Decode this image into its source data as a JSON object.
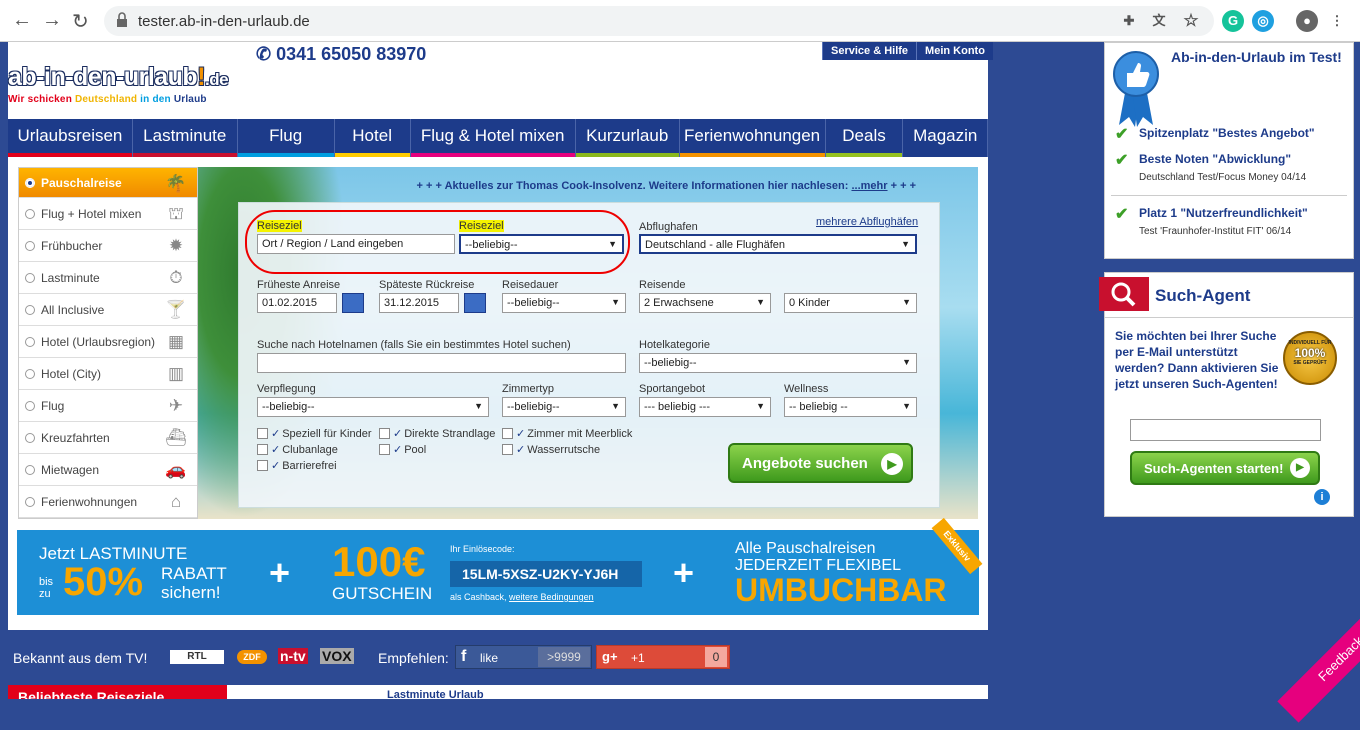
{
  "browser": {
    "url": "tester.ab-in-den-urlaub.de"
  },
  "header": {
    "phone": "0341 65050 83970",
    "service_btn": "Service & Hilfe",
    "account_btn": "Mein Konto",
    "logo_main": "ab-in-den-urlaub",
    "logo_excl": "!",
    "logo_de": ".de",
    "slogan_1": "Wir schicken ",
    "slogan_2": "Deutschland",
    "slogan_3": " in den ",
    "slogan_4": "Urlaub"
  },
  "nav": [
    {
      "label": "Urlaubsreisen",
      "color": "#e2001a"
    },
    {
      "label": "Lastminute",
      "color": "#c8102e"
    },
    {
      "label": "Flug",
      "color": "#009ee0"
    },
    {
      "label": "Hotel",
      "color": "#ffcc00"
    },
    {
      "label": "Flug & Hotel mixen",
      "color": "#e6007e"
    },
    {
      "label": "Kurzurlaub",
      "color": "#8ab81c"
    },
    {
      "label": "Ferienwohnungen",
      "color": "#f39200"
    },
    {
      "label": "Deals",
      "color": "#95c11f"
    },
    {
      "label": "Magazin",
      "color": "#1d3b8a"
    }
  ],
  "sidebar": [
    {
      "label": "Pauschalreise",
      "icon": "palm-icon"
    },
    {
      "label": "Flug + Hotel mixen",
      "icon": "eiffel-icon"
    },
    {
      "label": "Frühbucher",
      "icon": "sun-icon"
    },
    {
      "label": "Lastminute",
      "icon": "stopwatch-icon"
    },
    {
      "label": "All Inclusive",
      "icon": "cocktail-icon"
    },
    {
      "label": "Hotel (Urlaubsregion)",
      "icon": "suitcase-icon"
    },
    {
      "label": "Hotel (City)",
      "icon": "building-icon"
    },
    {
      "label": "Flug",
      "icon": "plane-icon"
    },
    {
      "label": "Kreuzfahrten",
      "icon": "ship-icon"
    },
    {
      "label": "Mietwagen",
      "icon": "car-icon"
    },
    {
      "label": "Ferienwohnungen",
      "icon": "house-icon"
    }
  ],
  "ticker": {
    "prefix": "+ + +",
    "text": "Aktuelles zur Thomas Cook-Insolvenz. Weitere Informationen hier nachlesen:",
    "link": "...mehr",
    "suffix": "+ + +"
  },
  "form": {
    "reiseziel_label": "Reiseziel",
    "reiseziel_placeholder": "Ort / Region / Land eingeben",
    "reiseziel2_label": "Reiseziel",
    "reiseziel2_value": "--beliebig--",
    "abflughafen_label": "Abflughafen",
    "mehrere_link": "mehrere Abflughäfen",
    "abflughafen_value": "Deutschland - alle Flughäfen",
    "frueheste_label": "Früheste Anreise",
    "frueheste_value": "01.02.2015",
    "spaeteste_label": "Späteste Rückreise",
    "spaeteste_value": "31.12.2015",
    "reisedauer_label": "Reisedauer",
    "reisedauer_value": "--beliebig--",
    "reisende_label": "Reisende",
    "erwachsene_value": "2 Erwachsene",
    "kinder_value": "0 Kinder",
    "hotelname_label": "Suche nach Hotelnamen (falls Sie ein bestimmtes Hotel suchen)",
    "hotelkat_label": "Hotelkategorie",
    "hotelkat_value": "--beliebig--",
    "verpflegung_label": "Verpflegung",
    "verpflegung_value": "--beliebig--",
    "zimmertyp_label": "Zimmertyp",
    "zimmertyp_value": "--beliebig--",
    "sportangebot_label": "Sportangebot",
    "sportangebot_value": "--- beliebig ---",
    "wellness_label": "Wellness",
    "wellness_value": "-- beliebig --",
    "checkboxes": [
      "Speziell für Kinder",
      "Clubanlage",
      "Barrierefrei",
      "Direkte Strandlage",
      "Pool",
      "Zimmer mit Meerblick",
      "Wasserrutsche"
    ],
    "submit": "Angebote suchen"
  },
  "banner": {
    "l1": "Jetzt LASTMINUTE",
    "bis": "bis",
    "zu": "zu",
    "pct": "50%",
    "rabatt": "RABATT",
    "sichern": "sichern!",
    "plus": "+",
    "gutschein_amt": "100€",
    "gutschein": "GUTSCHEIN",
    "code_label": "Ihr Einlösecode:",
    "code": "15LM-5XSZ-U2KY-YJ6H",
    "cashback": "als Cashback,",
    "bedingungen": "weitere Bedingungen",
    "r1": "Alle Pauschalreisen",
    "r2": "JEDERZEIT FLEXIBEL",
    "r3": "UMBUCHBAR",
    "exklusiv": "Exklusiv"
  },
  "bottom": {
    "tv": "Bekannt aus dem TV!",
    "rtl": "RTL",
    "zdf": "ZDF",
    "ntv": "n-tv",
    "vox": "VOX",
    "empfehlen": "Empfehlen:",
    "like": "like",
    "like_count": ">9999",
    "gplus": "+1",
    "gplus_count": "0",
    "cut1": "Beliebteste Reiseziele",
    "cut2": "Lastminute Urlaub"
  },
  "right1": {
    "title": "Ab-in-den-Urlaub im Test!",
    "items": [
      {
        "head": "Spitzenplatz \"Bestes Angebot\"",
        "sub": ""
      },
      {
        "head": "Beste Noten \"Abwicklung\"",
        "sub": "Deutschland Test/Focus Money 04/14"
      },
      {
        "head": "Platz 1 \"Nutzerfreundlichkeit\"",
        "sub": "Test 'Fraunhofer-Institut FIT' 06/14"
      }
    ]
  },
  "right2": {
    "title": "Such-Agent",
    "text": "Sie möchten bei Ihrer Suche per E-Mail unterstützt werden? Dann aktivieren Sie jetzt unseren Such-Agenten!",
    "seal_top": "INDIVIDUELL FÜR",
    "seal_pct": "100%",
    "seal_bot": "SIE GEPRÜFT",
    "button": "Such-Agenten starten!"
  },
  "feedback": "Feedback"
}
